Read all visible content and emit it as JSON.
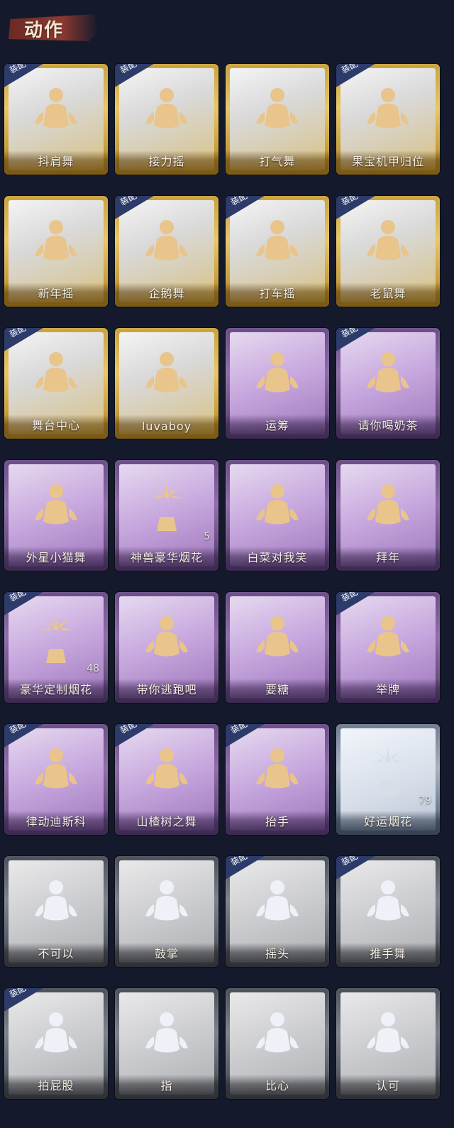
{
  "header": {
    "title": "动作"
  },
  "badge_text": "装配",
  "cards": [
    {
      "label": "抖肩舞",
      "rarity": "gold",
      "equipped": true,
      "icon": "emote-person-icon"
    },
    {
      "label": "接力摇",
      "rarity": "gold",
      "equipped": true,
      "icon": "emote-person-icon"
    },
    {
      "label": "打气舞",
      "rarity": "gold",
      "equipped": false,
      "icon": "emote-person-icon"
    },
    {
      "label": "果宝机甲归位",
      "rarity": "gold",
      "equipped": true,
      "icon": "emote-person-icon"
    },
    {
      "label": "新年摇",
      "rarity": "gold",
      "equipped": false,
      "icon": "emote-person-icon"
    },
    {
      "label": "企鹅舞",
      "rarity": "gold",
      "equipped": true,
      "icon": "emote-person-icon"
    },
    {
      "label": "打车摇",
      "rarity": "gold",
      "equipped": true,
      "icon": "emote-person-icon"
    },
    {
      "label": "老鼠舞",
      "rarity": "gold",
      "equipped": true,
      "icon": "emote-person-icon"
    },
    {
      "label": "舞台中心",
      "rarity": "gold",
      "equipped": true,
      "icon": "emote-person-icon"
    },
    {
      "label": "luvaboy",
      "rarity": "gold",
      "equipped": false,
      "icon": "emote-person-icon"
    },
    {
      "label": "运筹",
      "rarity": "purple",
      "equipped": false,
      "icon": "emote-person-icon"
    },
    {
      "label": "请你喝奶茶",
      "rarity": "purple",
      "equipped": true,
      "icon": "emote-person-icon"
    },
    {
      "label": "外星小猫舞",
      "rarity": "purple",
      "equipped": false,
      "icon": "emote-person-icon"
    },
    {
      "label": "神兽豪华烟花",
      "rarity": "purple",
      "equipped": false,
      "icon": "firework-icon",
      "count": "5"
    },
    {
      "label": "白菜对我笑",
      "rarity": "purple",
      "equipped": false,
      "icon": "emote-person-icon"
    },
    {
      "label": "拜年",
      "rarity": "purple",
      "equipped": false,
      "icon": "emote-person-icon"
    },
    {
      "label": "豪华定制烟花",
      "rarity": "purple",
      "equipped": true,
      "icon": "firework-icon",
      "count": "48"
    },
    {
      "label": "带你逃跑吧",
      "rarity": "purple",
      "equipped": false,
      "icon": "emote-person-icon"
    },
    {
      "label": "要糖",
      "rarity": "purple",
      "equipped": false,
      "icon": "emote-person-icon"
    },
    {
      "label": "举牌",
      "rarity": "purple",
      "equipped": true,
      "icon": "emote-person-icon"
    },
    {
      "label": "律动迪斯科",
      "rarity": "purple",
      "equipped": true,
      "icon": "emote-person-icon"
    },
    {
      "label": "山楂树之舞",
      "rarity": "purple",
      "equipped": true,
      "icon": "emote-person-icon"
    },
    {
      "label": "抬手",
      "rarity": "purple",
      "equipped": true,
      "icon": "emote-person-icon"
    },
    {
      "label": "好运烟花",
      "rarity": "blue",
      "equipped": false,
      "icon": "firework-icon",
      "count": "79"
    },
    {
      "label": "不可以",
      "rarity": "gray",
      "equipped": false,
      "icon": "emote-person-icon"
    },
    {
      "label": "鼓掌",
      "rarity": "gray",
      "equipped": false,
      "icon": "emote-person-icon"
    },
    {
      "label": "摇头",
      "rarity": "gray",
      "equipped": true,
      "icon": "emote-person-icon"
    },
    {
      "label": "推手舞",
      "rarity": "gray",
      "equipped": true,
      "icon": "emote-person-icon"
    },
    {
      "label": "拍屁股",
      "rarity": "gray",
      "equipped": true,
      "icon": "emote-person-icon"
    },
    {
      "label": "指",
      "rarity": "gray",
      "equipped": false,
      "icon": "emote-person-icon"
    },
    {
      "label": "比心",
      "rarity": "gray",
      "equipped": false,
      "icon": "emote-person-icon"
    },
    {
      "label": "认可",
      "rarity": "gray",
      "equipped": false,
      "icon": "emote-person-icon"
    }
  ]
}
